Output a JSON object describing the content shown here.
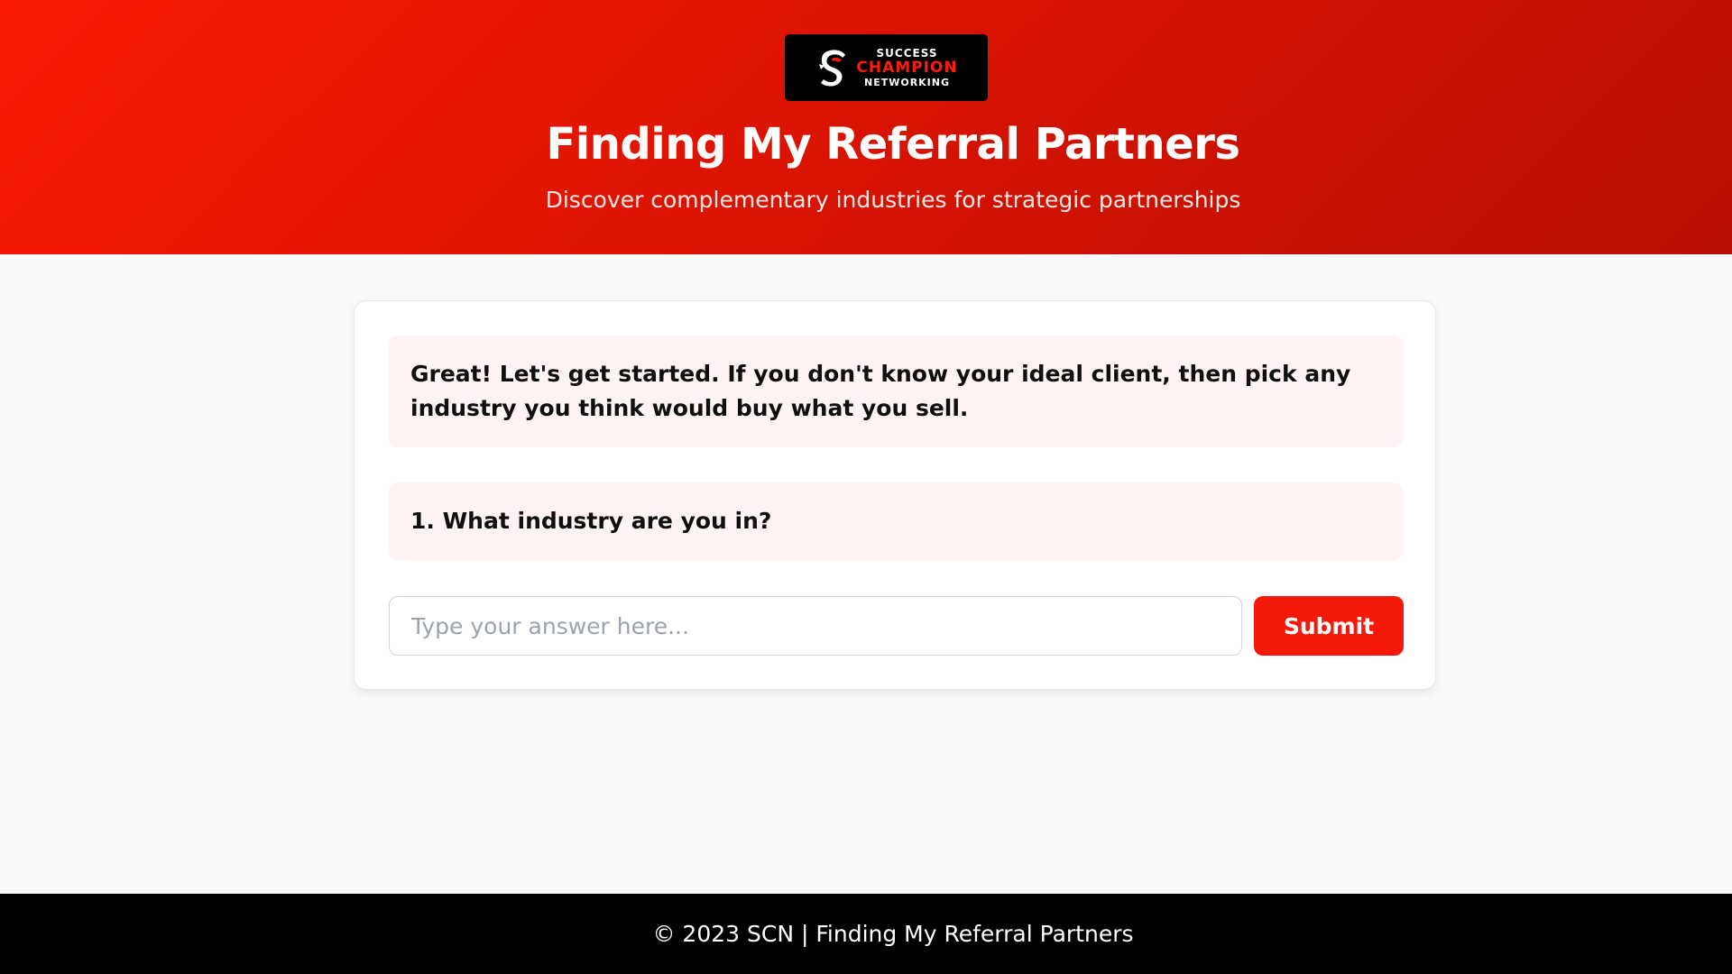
{
  "colors": {
    "header_gradient_start": "#fa1a05",
    "header_gradient_end": "#b80f02",
    "accent": "#f5190a",
    "message_bg": "#fff4f3",
    "footer_bg": "#000000"
  },
  "header": {
    "logo": {
      "line1": "SUCCESS",
      "line2": "CHAMPION",
      "line3": "NETWORKING",
      "icon": "helmet-icon"
    },
    "title": "Finding My Referral Partners",
    "subtitle": "Discover complementary industries for strategic partnerships"
  },
  "chat": {
    "messages": [
      "Great! Let's get started. If you don't know your ideal client, then pick any industry you think would buy what you sell.",
      "1. What industry are you in?"
    ],
    "input": {
      "value": "",
      "placeholder": "Type your answer here..."
    },
    "submit_label": "Submit"
  },
  "footer": {
    "text": "© 2023 SCN | Finding My Referral Partners"
  }
}
